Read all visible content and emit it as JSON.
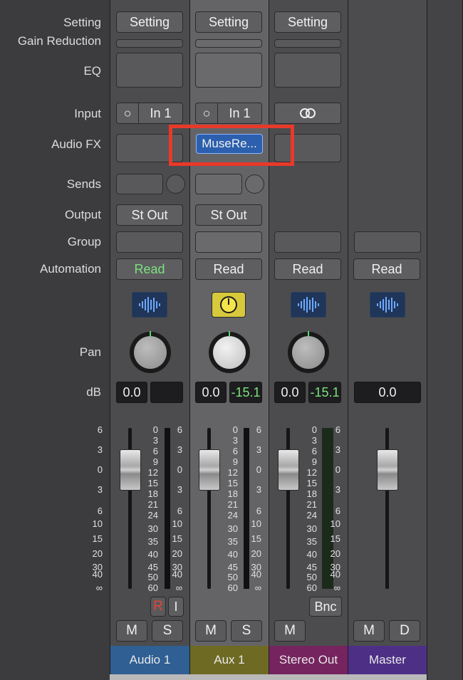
{
  "labels": {
    "setting": "Setting",
    "gain_reduction": "Gain Reduction",
    "eq": "EQ",
    "input": "Input",
    "audio_fx": "Audio FX",
    "sends": "Sends",
    "output": "Output",
    "group": "Group",
    "automation": "Automation",
    "pan": "Pan",
    "db": "dB"
  },
  "strips": {
    "audio1": {
      "setting": "Setting",
      "input": "In 1",
      "output": "St Out",
      "automation": "Read",
      "volume": "0.0",
      "name": "Audio 1",
      "mute": "M",
      "solo": "S",
      "rec": "R",
      "input_monitor": "I",
      "color": "#2f5f93"
    },
    "aux1": {
      "setting": "Setting",
      "input": "In 1",
      "audio_fx": "MuseRe...",
      "output": "St Out",
      "automation": "Read",
      "volume": "0.0",
      "peak": "-15.1",
      "name": "Aux 1",
      "mute": "M",
      "solo": "S",
      "color": "#6e6a24"
    },
    "stereo": {
      "setting": "Setting",
      "automation": "Read",
      "volume": "0.0",
      "peak": "-15.1",
      "name": "Stereo Out",
      "mute": "M",
      "bounce": "Bnc",
      "color": "#76245f"
    },
    "master": {
      "automation": "Read",
      "volume": "0.0",
      "name": "Master",
      "mute": "M",
      "dim": "D",
      "color": "#4d2f86"
    }
  },
  "fader_scale_left": [
    "6",
    "3",
    "0",
    "3",
    "6",
    "10",
    "15",
    "20",
    "30",
    "40",
    "∞"
  ],
  "meter_scale": [
    "0",
    "3",
    "6",
    "9",
    "12",
    "15",
    "18",
    "21",
    "24",
    "30",
    "35",
    "40",
    "45",
    "50",
    "60"
  ],
  "colors": {
    "highlight": "#e8392a",
    "automation_read_green": "#7be27d",
    "peak_green": "#7be27d"
  }
}
